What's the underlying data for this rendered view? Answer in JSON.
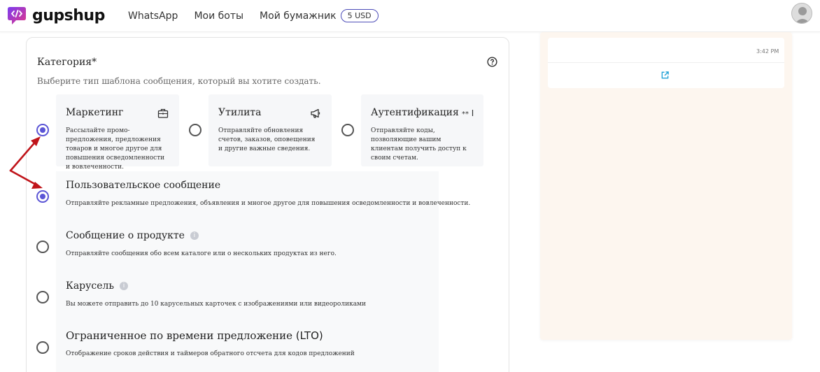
{
  "header": {
    "logo_text": "gupshup",
    "nav": [
      {
        "label": "WhatsApp"
      },
      {
        "label": "Мои боты"
      },
      {
        "label": "Мой бумажник"
      }
    ],
    "wallet_balance": "5 USD"
  },
  "form": {
    "category_label": "Категория*",
    "category_hint": "Выберите тип шаблона сообщения, который вы хотите создать.",
    "categories": [
      {
        "title": "Маркетинг",
        "icon": "briefcase-icon",
        "selected": true,
        "desc": "Рассылайте промо-предложения, предложения товаров и многое другое для повышения осведомленности и вовлеченности."
      },
      {
        "title": "Утилита",
        "icon": "megaphone-icon",
        "selected": false,
        "desc": "Отправляйте обновления счетов, заказов, оповещения и другие важные сведения."
      },
      {
        "title": "Аутентификация",
        "icon": "password-icon",
        "selected": false,
        "desc": "Отправляйте коды, позволяющие вашим клиентам получить доступ к своим счетам."
      }
    ],
    "subtypes": [
      {
        "title": "Пользовательское сообщение",
        "selected": true,
        "info": false,
        "desc": "Отправляйте рекламные предложения, объявления и многое другое для повышения осведомленности и вовлеченности."
      },
      {
        "title": "Сообщение о продукте",
        "selected": false,
        "info": true,
        "desc": "Отправляйте сообщения обо всем каталоге или о нескольких продуктах из него."
      },
      {
        "title": "Карусель",
        "selected": false,
        "info": true,
        "desc": "Вы можете отправить до 10 карусельных карточек с изображениями или видеороликами"
      },
      {
        "title_main": "Ограниченное по времени предложение ",
        "title_abbr": "(LTO)",
        "selected": false,
        "info": false,
        "desc": "Отображение сроков действия и таймеров обратного отсчета для кодов предложений"
      }
    ]
  },
  "preview": {
    "time": "3:42 PM"
  },
  "colors": {
    "accent": "#5b55d6",
    "arrow": "#c0141a",
    "preview_bg": "#fdf6ef"
  }
}
